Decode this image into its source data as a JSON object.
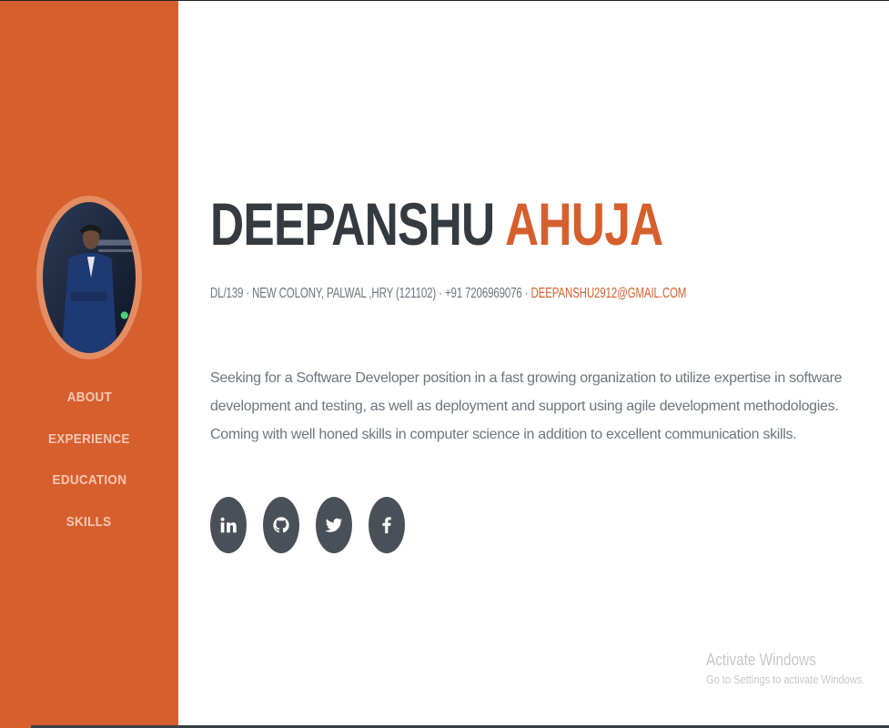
{
  "sidebar": {
    "avatar_alt": "profile photo",
    "nav": [
      {
        "label": "ABOUT"
      },
      {
        "label": "EXPERIENCE"
      },
      {
        "label": "EDUCATION"
      },
      {
        "label": "SKILLS"
      }
    ]
  },
  "header": {
    "first_name": "DEEPANSHU",
    "last_name": "AHUJA",
    "contact_text": "DL/139 · NEW COLONY, PALWAL ,HRY (121102) · +91 7206969076 ·",
    "email": "DEEPANSHU2912@GMAIL.COM"
  },
  "about": {
    "summary": "Seeking for a Software Developer position in a fast growing organization to utilize expertise in software development and testing, as well as deployment and support using agile development methodologies. Coming with well honed skills in computer science in addition to excellent communication skills."
  },
  "social": [
    {
      "icon": "linkedin-icon"
    },
    {
      "icon": "github-icon"
    },
    {
      "icon": "twitter-icon"
    },
    {
      "icon": "facebook-icon"
    }
  ],
  "watermark": {
    "title": "Activate Windows",
    "subtitle": "Go to Settings to activate Windows."
  },
  "colors": {
    "primary": "#d65f2e",
    "dark": "#343a40",
    "text": "#6c757d",
    "icon_bg": "#495057"
  }
}
